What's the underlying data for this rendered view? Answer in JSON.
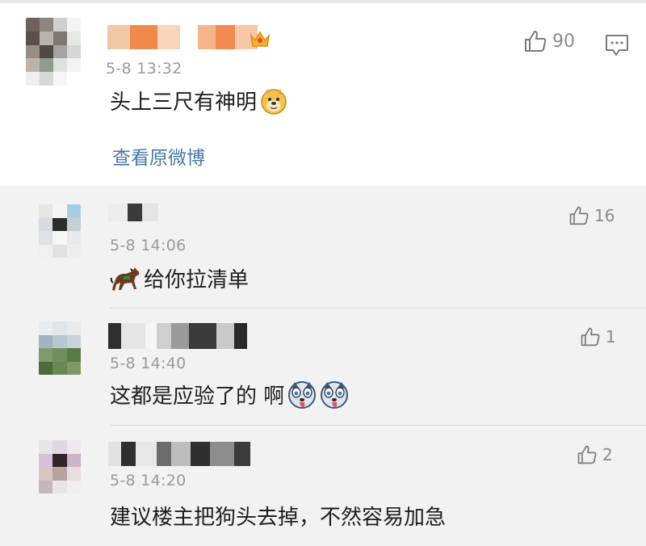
{
  "main_comment": {
    "timestamp": "5-8 13:32",
    "text": "头上三尺有神明",
    "likes": "90",
    "view_original_label": "查看原微博",
    "badge_icon": "crown-vip-icon",
    "emoji": "doge-emoji-icon",
    "menu_icon": "comment-menu-icon"
  },
  "replies": [
    {
      "timestamp": "5-8 14:06",
      "text": "给你拉清单",
      "prefix_emoji": "horse-emoji-icon",
      "likes": "16"
    },
    {
      "timestamp": "5-8 14:40",
      "text": "这都是应验了的 啊",
      "suffix_emojis": [
        "husky-emoji-icon",
        "husky-emoji-icon"
      ],
      "likes": "1"
    },
    {
      "timestamp": "5-8 14:20",
      "text": "建议楼主把狗头去掉，不然容易加急",
      "likes": "2"
    }
  ],
  "colors": {
    "link": "#4a78a8",
    "meta_text": "#9a9a9a",
    "main_bg": "#ffffff",
    "reply_bg": "#f2f2f2"
  }
}
